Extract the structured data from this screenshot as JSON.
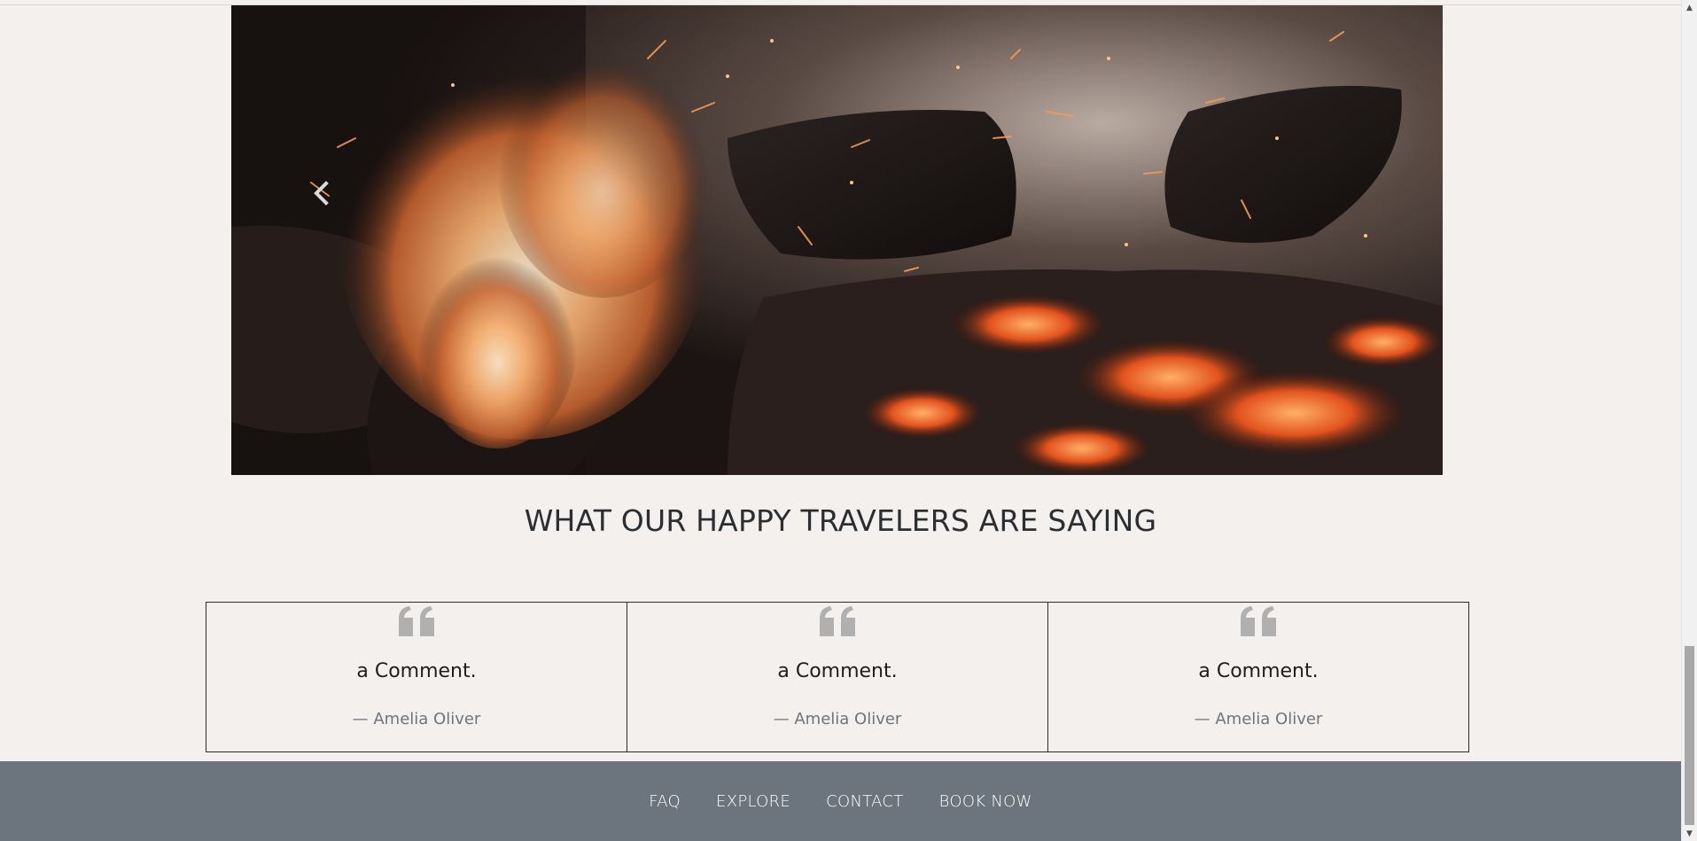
{
  "carousel": {
    "image_alt": "campfire embers",
    "prev_icon": "chevron-left-icon",
    "next_icon": "chevron-right-icon"
  },
  "testimonials_section": {
    "heading": "WHAT OUR HAPPY TRAVELERS ARE SAYING",
    "cards": [
      {
        "quote_icon": "quote-icon",
        "comment": "a Comment.",
        "author": "— Amelia Oliver"
      },
      {
        "quote_icon": "quote-icon",
        "comment": "a Comment.",
        "author": "— Amelia Oliver"
      },
      {
        "quote_icon": "quote-icon",
        "comment": "a Comment.",
        "author": "— Amelia Oliver"
      }
    ]
  },
  "footer": {
    "links": [
      "FAQ",
      "EXPLORE",
      "CONTACT",
      "BOOK NOW"
    ]
  },
  "scrollbar": {
    "up_glyph": "▲",
    "down_glyph": "▼"
  },
  "colors": {
    "page_background": "#f3f0ee",
    "footer_background": "#6c757d",
    "heading": "#2b2f33",
    "author_text": "#6c757d",
    "quote_icon": "#b0b0b0"
  }
}
